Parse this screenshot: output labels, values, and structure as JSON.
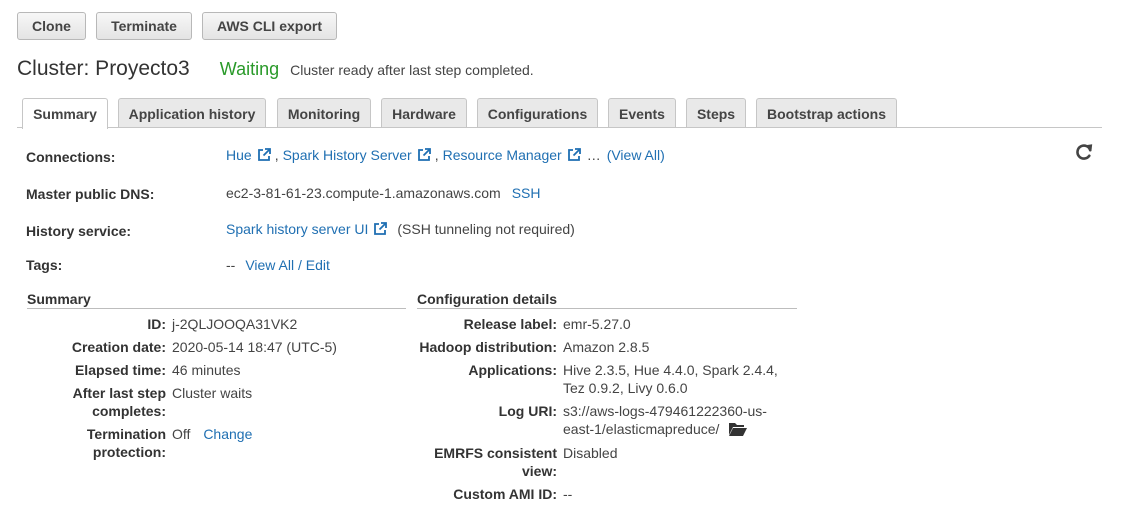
{
  "toolbar": {
    "clone": "Clone",
    "terminate": "Terminate",
    "cli_export": "AWS CLI export"
  },
  "header": {
    "title": "Cluster: Proyecto3",
    "status": "Waiting",
    "status_message": "Cluster ready after last step completed."
  },
  "tabs": [
    {
      "label": "Summary",
      "active": true
    },
    {
      "label": "Application history"
    },
    {
      "label": "Monitoring"
    },
    {
      "label": "Hardware"
    },
    {
      "label": "Configurations"
    },
    {
      "label": "Events"
    },
    {
      "label": "Steps"
    },
    {
      "label": "Bootstrap actions"
    }
  ],
  "overview": {
    "connections_label": "Connections:",
    "connections": [
      "Hue",
      "Spark History Server",
      "Resource Manager"
    ],
    "connections_sep": ",",
    "connections_more": "…",
    "view_all": "(View All)",
    "dns_label": "Master public DNS:",
    "dns_value": "ec2-3-81-61-23.compute-1.amazonaws.com",
    "ssh": "SSH",
    "history_label": "History service:",
    "history_link": "Spark history server UI",
    "history_note": "(SSH tunneling not required)",
    "tags_label": "Tags:",
    "tags_value": "--",
    "tags_link": "View All / Edit"
  },
  "summary": {
    "heading": "Summary",
    "id_label": "ID:",
    "id_value": "j-2QLJOOQA31VK2",
    "created_label": "Creation date:",
    "created_value": "2020-05-14 18:47 (UTC-5)",
    "elapsed_label": "Elapsed time:",
    "elapsed_value": "46 minutes",
    "after_step_label_1": "After last step",
    "after_step_label_2": "completes:",
    "after_step_value": "Cluster waits",
    "termination_label_1": "Termination",
    "termination_label_2": "protection:",
    "termination_value": "Off",
    "termination_change": "Change"
  },
  "config": {
    "heading": "Configuration details",
    "release_label": "Release label:",
    "release_value": "emr-5.27.0",
    "hadoop_label": "Hadoop distribution:",
    "hadoop_value": "Amazon 2.8.5",
    "apps_label": "Applications:",
    "apps_line1": "Hive 2.3.5, Hue 4.4.0, Spark 2.4.4,",
    "apps_line2": "Tez 0.9.2, Livy 0.6.0",
    "log_label": "Log URI:",
    "log_line1": "s3://aws-logs-479461222360-us-",
    "log_line2": "east-1/elasticmapreduce/",
    "emrfs_label_1": "EMRFS consistent",
    "emrfs_label_2": "view:",
    "emrfs_value": "Disabled",
    "ami_label": "Custom AMI ID:",
    "ami_value": "--"
  },
  "colors": {
    "status_green": "#2a9a2a",
    "link_blue": "#1f6fb2"
  },
  "icons": [
    "external-link-icon",
    "refresh-icon",
    "folder-open-icon"
  ]
}
